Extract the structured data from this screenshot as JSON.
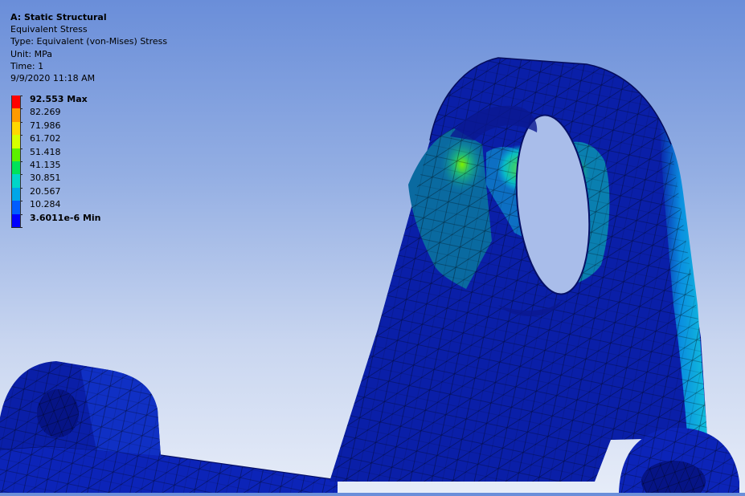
{
  "header": {
    "analysis_title": "A: Static Structural",
    "result_name": "Equivalent Stress",
    "result_type": "Type: Equivalent (von-Mises) Stress",
    "unit": "Unit: MPa",
    "time": "Time: 1",
    "timestamp": "9/9/2020 11:18 AM"
  },
  "legend": {
    "levels": [
      {
        "label": "92.553 Max",
        "value": 92.553,
        "bold": true
      },
      {
        "label": "82.269",
        "value": 82.269,
        "bold": false
      },
      {
        "label": "71.986",
        "value": 71.986,
        "bold": false
      },
      {
        "label": "61.702",
        "value": 61.702,
        "bold": false
      },
      {
        "label": "51.418",
        "value": 51.418,
        "bold": false
      },
      {
        "label": "41.135",
        "value": 41.135,
        "bold": false
      },
      {
        "label": "30.851",
        "value": 30.851,
        "bold": false
      },
      {
        "label": "20.567",
        "value": 20.567,
        "bold": false
      },
      {
        "label": "10.284",
        "value": 10.284,
        "bold": false
      },
      {
        "label": "3.6011e-6 Min",
        "value": 3.6011e-06,
        "bold": true
      }
    ],
    "colors": [
      "#ff0000",
      "#ff9a00",
      "#ffd800",
      "#d6ff00",
      "#5cf000",
      "#00e25a",
      "#00d6c8",
      "#00a6e8",
      "#005cff",
      "#0000ff"
    ]
  },
  "colors": {
    "mesh_base": "#0a1fa8",
    "mesh_lines": "#000000",
    "background_top": "#6a8ed9",
    "background_bottom": "#e6ecf8"
  }
}
